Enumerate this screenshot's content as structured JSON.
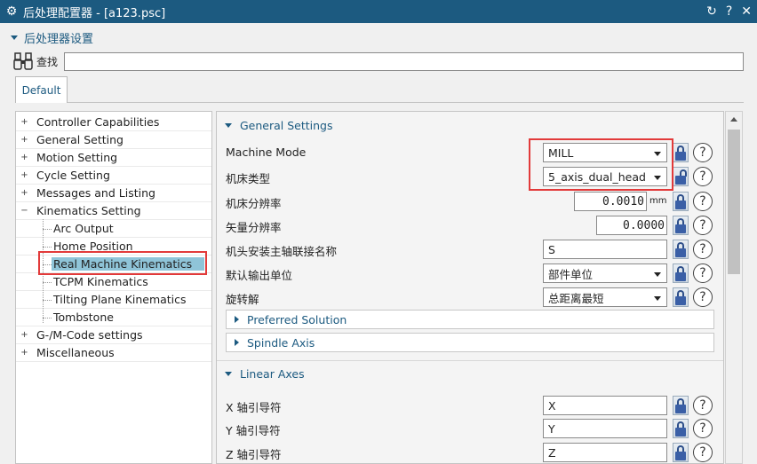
{
  "window": {
    "title": "后处理配置器 - [a123.psc]",
    "buttons": [
      "↻",
      "?",
      "✕"
    ]
  },
  "section_title": "后处理器设置",
  "search": {
    "label": "查找",
    "value": ""
  },
  "tabs": [
    {
      "label": "Default",
      "active": true
    }
  ],
  "tree": {
    "items": [
      {
        "label": "Controller Capabilities",
        "expander": "+"
      },
      {
        "label": "General Setting",
        "expander": "+"
      },
      {
        "label": "Motion Setting",
        "expander": "+"
      },
      {
        "label": "Cycle Setting",
        "expander": "+"
      },
      {
        "label": "Messages and Listing",
        "expander": "+"
      },
      {
        "label": "Kinematics Setting",
        "expander": "−"
      },
      {
        "label": "Arc Output",
        "expander": ""
      },
      {
        "label": "Home Position",
        "expander": ""
      },
      {
        "label": "Real Machine Kinematics",
        "expander": "",
        "selected": true
      },
      {
        "label": "TCPM Kinematics",
        "expander": ""
      },
      {
        "label": "Tilting Plane Kinematics",
        "expander": ""
      },
      {
        "label": "Tombstone",
        "expander": ""
      },
      {
        "label": "G-/M-Code settings",
        "expander": "+"
      },
      {
        "label": "Miscellaneous",
        "expander": "+"
      }
    ]
  },
  "general_settings": {
    "header": "General Settings",
    "rows": [
      {
        "label": "Machine Mode",
        "value": "MILL",
        "type": "dropdown"
      },
      {
        "label": "机床类型",
        "value": "5_axis_dual_head",
        "type": "dropdown"
      },
      {
        "label": "机床分辨率",
        "value": "0.0010",
        "unit": "mm",
        "type": "number"
      },
      {
        "label": "矢量分辨率",
        "value": "0.0000",
        "type": "number"
      },
      {
        "label": "机头安装主轴联接名称",
        "value": "S",
        "type": "text"
      },
      {
        "label": "默认输出单位",
        "value": "部件单位",
        "type": "dropdown"
      },
      {
        "label": "旋转解",
        "value": "总距离最短",
        "type": "dropdown"
      }
    ],
    "subgroups": [
      "Preferred Solution",
      "Spindle Axis"
    ]
  },
  "linear_axes": {
    "header": "Linear Axes",
    "rows": [
      {
        "label": "X 轴引导符",
        "value": "X"
      },
      {
        "label": "Y 轴引导符",
        "value": "Y"
      },
      {
        "label": "Z 轴引导符",
        "value": "Z"
      }
    ]
  },
  "help_glyph": "?",
  "colors": {
    "titlebar": "#1c5a80",
    "accent": "#1c5a80",
    "selection": "#8fc4d8",
    "highlight_box": "#e23a3a"
  }
}
